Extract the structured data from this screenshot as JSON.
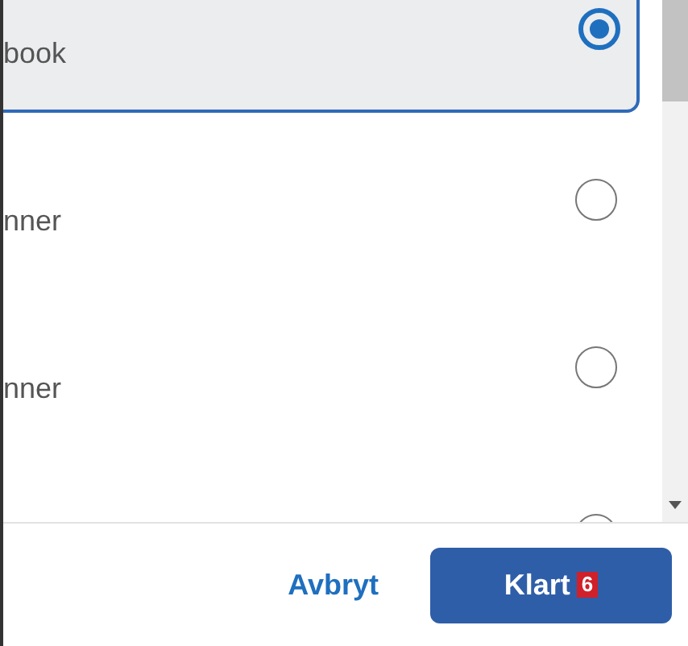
{
  "options": [
    {
      "label": "book",
      "selected": true
    },
    {
      "label": "nner",
      "selected": false
    },
    {
      "label": "nner",
      "selected": false
    },
    {
      "selected": false
    }
  ],
  "footer": {
    "cancel": "Avbryt",
    "done": "Klart",
    "done_badge": "6"
  }
}
